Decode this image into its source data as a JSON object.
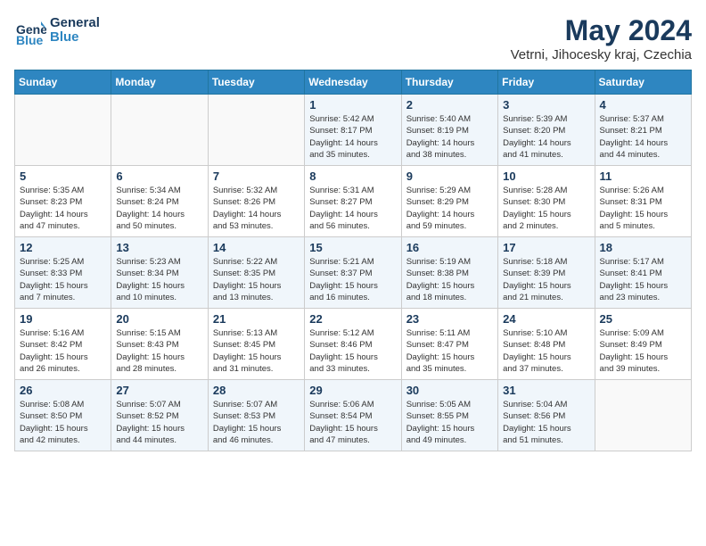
{
  "logo": {
    "line1": "General",
    "line2": "Blue"
  },
  "title": "May 2024",
  "location": "Vetrni, Jihocesky kraj, Czechia",
  "days_of_week": [
    "Sunday",
    "Monday",
    "Tuesday",
    "Wednesday",
    "Thursday",
    "Friday",
    "Saturday"
  ],
  "weeks": [
    [
      {
        "day": "",
        "info": ""
      },
      {
        "day": "",
        "info": ""
      },
      {
        "day": "",
        "info": ""
      },
      {
        "day": "1",
        "info": "Sunrise: 5:42 AM\nSunset: 8:17 PM\nDaylight: 14 hours\nand 35 minutes."
      },
      {
        "day": "2",
        "info": "Sunrise: 5:40 AM\nSunset: 8:19 PM\nDaylight: 14 hours\nand 38 minutes."
      },
      {
        "day": "3",
        "info": "Sunrise: 5:39 AM\nSunset: 8:20 PM\nDaylight: 14 hours\nand 41 minutes."
      },
      {
        "day": "4",
        "info": "Sunrise: 5:37 AM\nSunset: 8:21 PM\nDaylight: 14 hours\nand 44 minutes."
      }
    ],
    [
      {
        "day": "5",
        "info": "Sunrise: 5:35 AM\nSunset: 8:23 PM\nDaylight: 14 hours\nand 47 minutes."
      },
      {
        "day": "6",
        "info": "Sunrise: 5:34 AM\nSunset: 8:24 PM\nDaylight: 14 hours\nand 50 minutes."
      },
      {
        "day": "7",
        "info": "Sunrise: 5:32 AM\nSunset: 8:26 PM\nDaylight: 14 hours\nand 53 minutes."
      },
      {
        "day": "8",
        "info": "Sunrise: 5:31 AM\nSunset: 8:27 PM\nDaylight: 14 hours\nand 56 minutes."
      },
      {
        "day": "9",
        "info": "Sunrise: 5:29 AM\nSunset: 8:29 PM\nDaylight: 14 hours\nand 59 minutes."
      },
      {
        "day": "10",
        "info": "Sunrise: 5:28 AM\nSunset: 8:30 PM\nDaylight: 15 hours\nand 2 minutes."
      },
      {
        "day": "11",
        "info": "Sunrise: 5:26 AM\nSunset: 8:31 PM\nDaylight: 15 hours\nand 5 minutes."
      }
    ],
    [
      {
        "day": "12",
        "info": "Sunrise: 5:25 AM\nSunset: 8:33 PM\nDaylight: 15 hours\nand 7 minutes."
      },
      {
        "day": "13",
        "info": "Sunrise: 5:23 AM\nSunset: 8:34 PM\nDaylight: 15 hours\nand 10 minutes."
      },
      {
        "day": "14",
        "info": "Sunrise: 5:22 AM\nSunset: 8:35 PM\nDaylight: 15 hours\nand 13 minutes."
      },
      {
        "day": "15",
        "info": "Sunrise: 5:21 AM\nSunset: 8:37 PM\nDaylight: 15 hours\nand 16 minutes."
      },
      {
        "day": "16",
        "info": "Sunrise: 5:19 AM\nSunset: 8:38 PM\nDaylight: 15 hours\nand 18 minutes."
      },
      {
        "day": "17",
        "info": "Sunrise: 5:18 AM\nSunset: 8:39 PM\nDaylight: 15 hours\nand 21 minutes."
      },
      {
        "day": "18",
        "info": "Sunrise: 5:17 AM\nSunset: 8:41 PM\nDaylight: 15 hours\nand 23 minutes."
      }
    ],
    [
      {
        "day": "19",
        "info": "Sunrise: 5:16 AM\nSunset: 8:42 PM\nDaylight: 15 hours\nand 26 minutes."
      },
      {
        "day": "20",
        "info": "Sunrise: 5:15 AM\nSunset: 8:43 PM\nDaylight: 15 hours\nand 28 minutes."
      },
      {
        "day": "21",
        "info": "Sunrise: 5:13 AM\nSunset: 8:45 PM\nDaylight: 15 hours\nand 31 minutes."
      },
      {
        "day": "22",
        "info": "Sunrise: 5:12 AM\nSunset: 8:46 PM\nDaylight: 15 hours\nand 33 minutes."
      },
      {
        "day": "23",
        "info": "Sunrise: 5:11 AM\nSunset: 8:47 PM\nDaylight: 15 hours\nand 35 minutes."
      },
      {
        "day": "24",
        "info": "Sunrise: 5:10 AM\nSunset: 8:48 PM\nDaylight: 15 hours\nand 37 minutes."
      },
      {
        "day": "25",
        "info": "Sunrise: 5:09 AM\nSunset: 8:49 PM\nDaylight: 15 hours\nand 39 minutes."
      }
    ],
    [
      {
        "day": "26",
        "info": "Sunrise: 5:08 AM\nSunset: 8:50 PM\nDaylight: 15 hours\nand 42 minutes."
      },
      {
        "day": "27",
        "info": "Sunrise: 5:07 AM\nSunset: 8:52 PM\nDaylight: 15 hours\nand 44 minutes."
      },
      {
        "day": "28",
        "info": "Sunrise: 5:07 AM\nSunset: 8:53 PM\nDaylight: 15 hours\nand 46 minutes."
      },
      {
        "day": "29",
        "info": "Sunrise: 5:06 AM\nSunset: 8:54 PM\nDaylight: 15 hours\nand 47 minutes."
      },
      {
        "day": "30",
        "info": "Sunrise: 5:05 AM\nSunset: 8:55 PM\nDaylight: 15 hours\nand 49 minutes."
      },
      {
        "day": "31",
        "info": "Sunrise: 5:04 AM\nSunset: 8:56 PM\nDaylight: 15 hours\nand 51 minutes."
      },
      {
        "day": "",
        "info": ""
      }
    ]
  ]
}
